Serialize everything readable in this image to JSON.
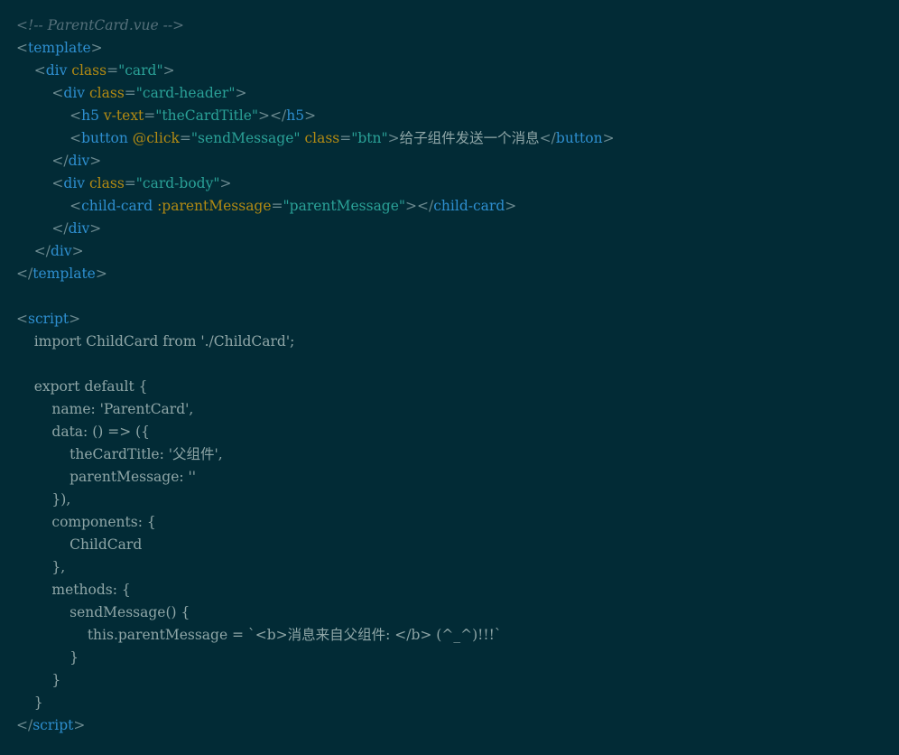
{
  "file_comment": "ParentCard.vue",
  "colors": {
    "background": "#022b36",
    "tag": "#2e8fd0",
    "attribute": "#b28a13",
    "string": "#2aa197",
    "text": "#8fa6a7",
    "comment": "#55707a"
  },
  "lines": [
    [
      {
        "t": "<!-- ParentCard.vue -->",
        "c": "comment"
      }
    ],
    [
      {
        "t": "<",
        "c": "punct"
      },
      {
        "t": "template",
        "c": "tag"
      },
      {
        "t": ">",
        "c": "punct"
      }
    ],
    [
      {
        "t": "    ",
        "c": "plain"
      },
      {
        "t": "<",
        "c": "punct"
      },
      {
        "t": "div",
        "c": "tag"
      },
      {
        "t": " ",
        "c": "plain"
      },
      {
        "t": "class",
        "c": "attr"
      },
      {
        "t": "=",
        "c": "punct"
      },
      {
        "t": "\"card\"",
        "c": "str"
      },
      {
        "t": ">",
        "c": "punct"
      }
    ],
    [
      {
        "t": "        ",
        "c": "plain"
      },
      {
        "t": "<",
        "c": "punct"
      },
      {
        "t": "div",
        "c": "tag"
      },
      {
        "t": " ",
        "c": "plain"
      },
      {
        "t": "class",
        "c": "attr"
      },
      {
        "t": "=",
        "c": "punct"
      },
      {
        "t": "\"card-header\"",
        "c": "str"
      },
      {
        "t": ">",
        "c": "punct"
      }
    ],
    [
      {
        "t": "            ",
        "c": "plain"
      },
      {
        "t": "<",
        "c": "punct"
      },
      {
        "t": "h5",
        "c": "tag"
      },
      {
        "t": " ",
        "c": "plain"
      },
      {
        "t": "v-text",
        "c": "attr"
      },
      {
        "t": "=",
        "c": "punct"
      },
      {
        "t": "\"theCardTitle\"",
        "c": "str"
      },
      {
        "t": "></",
        "c": "punct"
      },
      {
        "t": "h5",
        "c": "tag"
      },
      {
        "t": ">",
        "c": "punct"
      }
    ],
    [
      {
        "t": "            ",
        "c": "plain"
      },
      {
        "t": "<",
        "c": "punct"
      },
      {
        "t": "button",
        "c": "tag"
      },
      {
        "t": " ",
        "c": "plain"
      },
      {
        "t": "@click",
        "c": "attr"
      },
      {
        "t": "=",
        "c": "punct"
      },
      {
        "t": "\"sendMessage\"",
        "c": "str"
      },
      {
        "t": " ",
        "c": "plain"
      },
      {
        "t": "class",
        "c": "attr"
      },
      {
        "t": "=",
        "c": "punct"
      },
      {
        "t": "\"btn\"",
        "c": "str"
      },
      {
        "t": ">",
        "c": "punct"
      },
      {
        "t": "给子组件发送一个消息",
        "c": "text"
      },
      {
        "t": "</",
        "c": "punct"
      },
      {
        "t": "button",
        "c": "tag"
      },
      {
        "t": ">",
        "c": "punct"
      }
    ],
    [
      {
        "t": "        ",
        "c": "plain"
      },
      {
        "t": "</",
        "c": "punct"
      },
      {
        "t": "div",
        "c": "tag"
      },
      {
        "t": ">",
        "c": "punct"
      }
    ],
    [
      {
        "t": "        ",
        "c": "plain"
      },
      {
        "t": "<",
        "c": "punct"
      },
      {
        "t": "div",
        "c": "tag"
      },
      {
        "t": " ",
        "c": "plain"
      },
      {
        "t": "class",
        "c": "attr"
      },
      {
        "t": "=",
        "c": "punct"
      },
      {
        "t": "\"card-body\"",
        "c": "str"
      },
      {
        "t": ">",
        "c": "punct"
      }
    ],
    [
      {
        "t": "            ",
        "c": "plain"
      },
      {
        "t": "<",
        "c": "punct"
      },
      {
        "t": "child-card",
        "c": "tag"
      },
      {
        "t": " ",
        "c": "plain"
      },
      {
        "t": ":parentMessage",
        "c": "attr"
      },
      {
        "t": "=",
        "c": "punct"
      },
      {
        "t": "\"parentMessage\"",
        "c": "str"
      },
      {
        "t": "></",
        "c": "punct"
      },
      {
        "t": "child-card",
        "c": "tag"
      },
      {
        "t": ">",
        "c": "punct"
      }
    ],
    [
      {
        "t": "        ",
        "c": "plain"
      },
      {
        "t": "</",
        "c": "punct"
      },
      {
        "t": "div",
        "c": "tag"
      },
      {
        "t": ">",
        "c": "punct"
      }
    ],
    [
      {
        "t": "    ",
        "c": "plain"
      },
      {
        "t": "</",
        "c": "punct"
      },
      {
        "t": "div",
        "c": "tag"
      },
      {
        "t": ">",
        "c": "punct"
      }
    ],
    [
      {
        "t": "</",
        "c": "punct"
      },
      {
        "t": "template",
        "c": "tag"
      },
      {
        "t": ">",
        "c": "punct"
      }
    ],
    [],
    [
      {
        "t": "<",
        "c": "punct"
      },
      {
        "t": "script",
        "c": "tag"
      },
      {
        "t": ">",
        "c": "punct"
      }
    ],
    [
      {
        "t": "    import ChildCard from './ChildCard';",
        "c": "plain"
      }
    ],
    [],
    [
      {
        "t": "    export default {",
        "c": "plain"
      }
    ],
    [
      {
        "t": "        name: 'ParentCard',",
        "c": "plain"
      }
    ],
    [
      {
        "t": "        data: () => ({",
        "c": "plain"
      }
    ],
    [
      {
        "t": "            theCardTitle: '父组件',",
        "c": "plain"
      }
    ],
    [
      {
        "t": "            parentMessage: ''",
        "c": "plain"
      }
    ],
    [
      {
        "t": "        }),",
        "c": "plain"
      }
    ],
    [
      {
        "t": "        components: {",
        "c": "plain"
      }
    ],
    [
      {
        "t": "            ChildCard",
        "c": "plain"
      }
    ],
    [
      {
        "t": "        },",
        "c": "plain"
      }
    ],
    [
      {
        "t": "        methods: {",
        "c": "plain"
      }
    ],
    [
      {
        "t": "            sendMessage() {",
        "c": "plain"
      }
    ],
    [
      {
        "t": "                this.parentMessage = `<b>消息来自父组件: </b> (^_^)!!!`",
        "c": "plain"
      }
    ],
    [
      {
        "t": "            }",
        "c": "plain"
      }
    ],
    [
      {
        "t": "        }",
        "c": "plain"
      }
    ],
    [
      {
        "t": "    }",
        "c": "plain"
      }
    ],
    [
      {
        "t": "</",
        "c": "punct"
      },
      {
        "t": "script",
        "c": "tag"
      },
      {
        "t": ">",
        "c": "punct"
      }
    ]
  ]
}
